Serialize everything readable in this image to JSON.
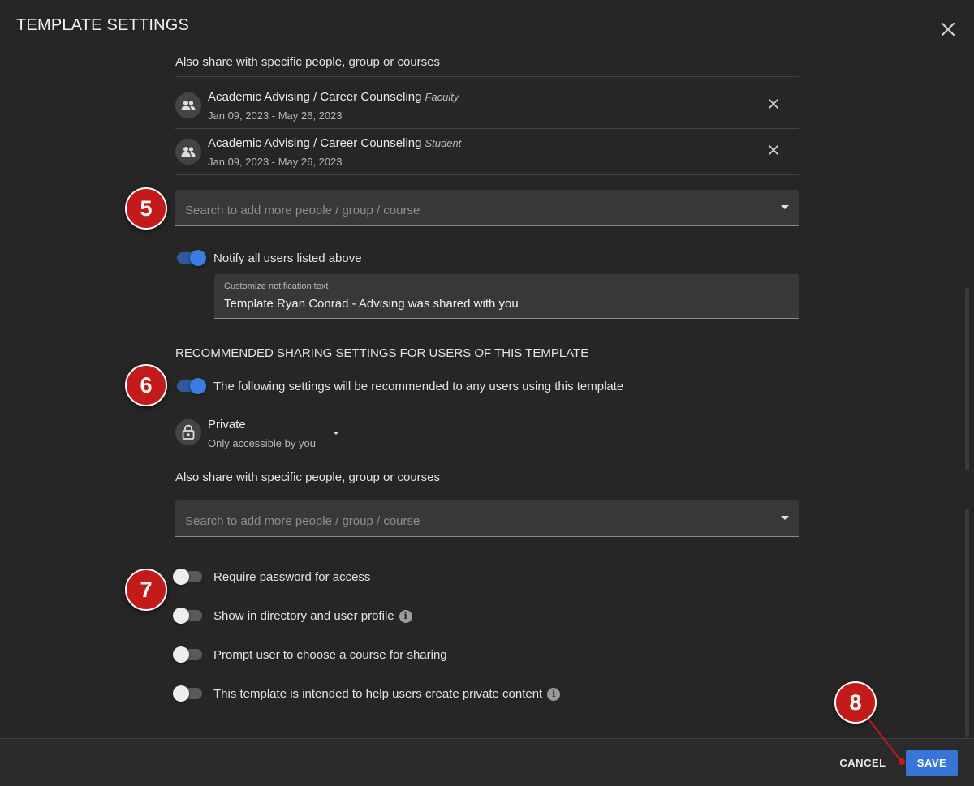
{
  "dialog": {
    "title": "TEMPLATE SETTINGS"
  },
  "share_section": {
    "heading": "Also share with specific people, group or courses",
    "items": [
      {
        "name": "Academic Advising / Career Counseling",
        "role": "Faculty",
        "dates": "Jan 09, 2023 - May 26, 2023",
        "icon": "group-icon"
      },
      {
        "name": "Academic Advising / Career Counseling",
        "role": "Student",
        "dates": "Jan 09, 2023 - May 26, 2023",
        "icon": "group-icon"
      }
    ],
    "search_placeholder": "Search to add more people / group / course"
  },
  "notify": {
    "label": "Notify all users listed above",
    "enabled": true,
    "field_label": "Customize notification text",
    "field_value": "Template Ryan Conrad - Advising was shared with you"
  },
  "recommended": {
    "heading": "RECOMMENDED SHARING SETTINGS FOR USERS OF THIS TEMPLATE",
    "toggle_label": "The following settings will be recommended to any users using this template",
    "enabled": true,
    "privacy": {
      "title": "Private",
      "subtitle": "Only accessible by you",
      "icon": "lock-icon"
    },
    "share_heading": "Also share with specific people, group or courses",
    "search_placeholder": "Search to add more people / group / course"
  },
  "options": [
    {
      "label": "Require password for access",
      "enabled": false,
      "info": false
    },
    {
      "label": "Show in directory and user profile",
      "enabled": false,
      "info": true
    },
    {
      "label": "Prompt user to choose a course for sharing",
      "enabled": false,
      "info": false
    },
    {
      "label": "This template is intended to help users create private content",
      "enabled": false,
      "info": true
    }
  ],
  "callouts": {
    "b5": "5",
    "b6": "6",
    "b7": "7",
    "b8": "8"
  },
  "footer": {
    "cancel": "CANCEL",
    "save": "SAVE"
  },
  "colors": {
    "accent": "#3875d7",
    "callout": "#c41a1a",
    "background": "#262626"
  }
}
